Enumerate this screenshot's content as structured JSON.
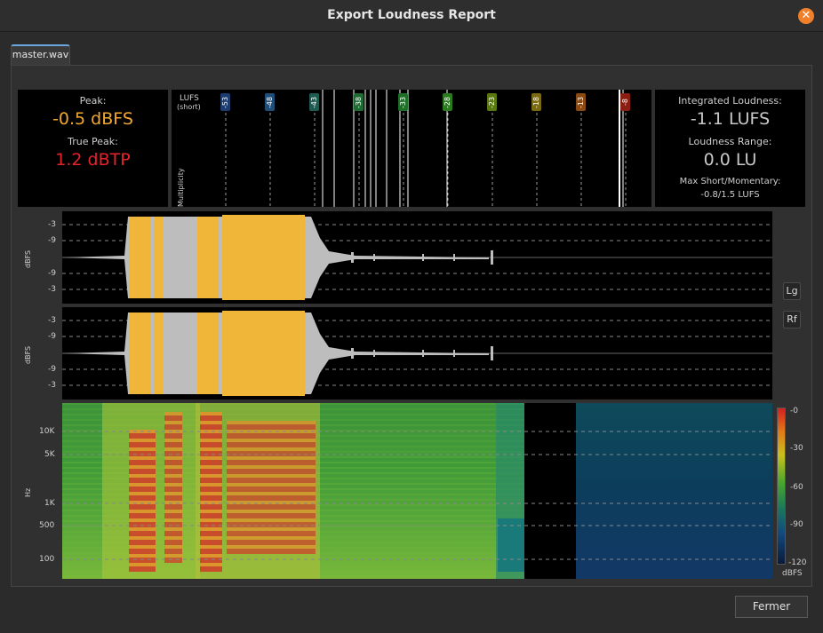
{
  "window": {
    "title": "Export Loudness Report",
    "close": "✕"
  },
  "tab": {
    "label": "master.wav"
  },
  "peak": {
    "peak_label": "Peak:",
    "peak_value": "-0.5 dBFS",
    "true_peak_label": "True Peak:",
    "true_peak_value": "1.2 dBTP"
  },
  "histogram": {
    "lufs_label": "LUFS",
    "short_label": "(short)",
    "multiplicity_label": "Multiplicity",
    "ticks": [
      {
        "label": "-53",
        "color": "#1c3b6e"
      },
      {
        "label": "-48",
        "color": "#1f4e78"
      },
      {
        "label": "-43",
        "color": "#1f5a52"
      },
      {
        "label": "-38",
        "color": "#1e6a32"
      },
      {
        "label": "-33",
        "color": "#1e7028"
      },
      {
        "label": "-28",
        "color": "#2a7a1e"
      },
      {
        "label": "-23",
        "color": "#5a7a10"
      },
      {
        "label": "-18",
        "color": "#7a6a12"
      },
      {
        "label": "-13",
        "color": "#8a4a12"
      },
      {
        "label": "-8",
        "color": "#8a1e12"
      }
    ]
  },
  "loudness": {
    "integrated_label": "Integrated Loudness:",
    "integrated_value": "-1.1 LUFS",
    "range_label": "Loudness Range:",
    "range_value": "0.0 LU",
    "max_label": "Max Short/Momentary:",
    "max_value": "-0.8/1.5 LUFS"
  },
  "waveform": {
    "ylabel": "dBFS",
    "ticks": [
      "-3",
      "-9",
      "-9",
      "-3"
    ],
    "btn_log": "Lg",
    "btn_rect": "Rf"
  },
  "spectrogram": {
    "ylabel": "Hz",
    "freq_ticks": [
      "10K",
      "5K",
      "1K",
      "500",
      "100"
    ],
    "colorbar_ticks": [
      "-0",
      "-30",
      "-60",
      "-90",
      "-120"
    ],
    "colorbar_unit": "dBFS"
  },
  "footer": {
    "close_button": "Fermer"
  }
}
